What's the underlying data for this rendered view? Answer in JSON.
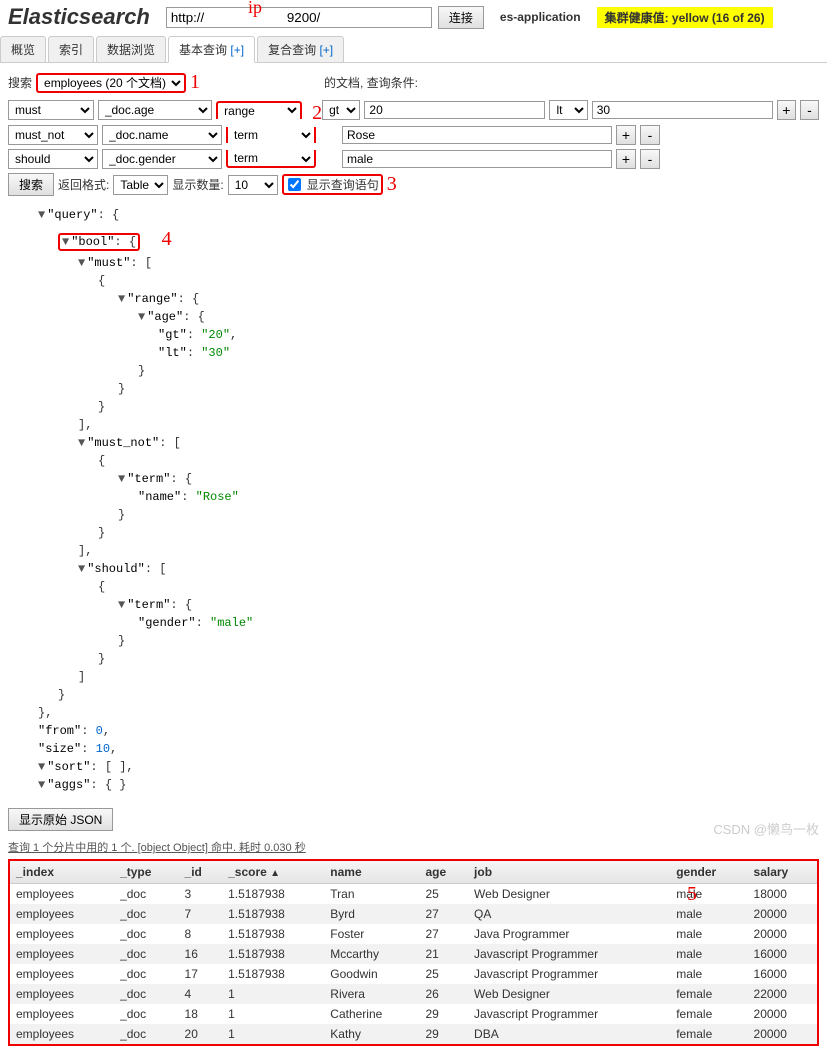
{
  "header": {
    "logo": "Elasticsearch",
    "url_prefix": "http://",
    "url_suffix": "9200/",
    "ip_annotation": "ip",
    "connect": "连接",
    "app_name": "es-application",
    "health": "集群健康值: yellow (16 of 26)"
  },
  "tabs": {
    "overview": "概览",
    "indices": "索引",
    "browse": "数据浏览",
    "basic": "基本查询",
    "compound": "复合查询",
    "plus": "[+]"
  },
  "search": {
    "label": "搜索",
    "index_value": "employees (20 个文档)",
    "docs_label": "的文档, 查询条件:",
    "rows": [
      {
        "bool": "must",
        "field": "_doc.age",
        "op": "range",
        "param": "gt",
        "val1": "20",
        "param2": "lt",
        "val2": "30"
      },
      {
        "bool": "must_not",
        "field": "_doc.name",
        "op": "term",
        "val": "Rose"
      },
      {
        "bool": "should",
        "field": "_doc.gender",
        "op": "term",
        "val": "male"
      }
    ],
    "submit": "搜索",
    "format_label": "返回格式:",
    "format": "Table",
    "count_label": "显示数量:",
    "count": "10",
    "show_query": "显示查询语句"
  },
  "annotations": {
    "a1": "1",
    "a2": "2",
    "a3": "3",
    "a4": "4",
    "a5": "5"
  },
  "json": {
    "query": "\"query\"",
    "bool": "\"bool\"",
    "must": "\"must\"",
    "range": "\"range\"",
    "age": "\"age\"",
    "gt": "\"gt\"",
    "gt_v": "\"20\"",
    "lt": "\"lt\"",
    "lt_v": "\"30\"",
    "must_not": "\"must_not\"",
    "term": "\"term\"",
    "name": "\"name\"",
    "name_v": "\"Rose\"",
    "should": "\"should\"",
    "gender": "\"gender\"",
    "gender_v": "\"male\"",
    "from": "\"from\"",
    "from_v": "0",
    "size": "\"size\"",
    "size_v": "10",
    "sort": "\"sort\"",
    "aggs": "\"aggs\""
  },
  "raw_json_btn": "显示原始 JSON",
  "stats": "查询 1 个分片中用的 1 个. [object Object] 命中. 耗时 0.030 秒",
  "table": {
    "headers": {
      "index": "_index",
      "type": "_type",
      "id": "_id",
      "score": "_score",
      "name": "name",
      "age": "age",
      "job": "job",
      "gender": "gender",
      "salary": "salary"
    },
    "sort_indicator": "▲",
    "rows": [
      {
        "index": "employees",
        "type": "_doc",
        "id": "3",
        "score": "1.5187938",
        "name": "Tran",
        "age": "25",
        "job": "Web Designer",
        "gender": "male",
        "salary": "18000"
      },
      {
        "index": "employees",
        "type": "_doc",
        "id": "7",
        "score": "1.5187938",
        "name": "Byrd",
        "age": "27",
        "job": "QA",
        "gender": "male",
        "salary": "20000"
      },
      {
        "index": "employees",
        "type": "_doc",
        "id": "8",
        "score": "1.5187938",
        "name": "Foster",
        "age": "27",
        "job": "Java Programmer",
        "gender": "male",
        "salary": "20000"
      },
      {
        "index": "employees",
        "type": "_doc",
        "id": "16",
        "score": "1.5187938",
        "name": "Mccarthy",
        "age": "21",
        "job": "Javascript Programmer",
        "gender": "male",
        "salary": "16000"
      },
      {
        "index": "employees",
        "type": "_doc",
        "id": "17",
        "score": "1.5187938",
        "name": "Goodwin",
        "age": "25",
        "job": "Javascript Programmer",
        "gender": "male",
        "salary": "16000"
      },
      {
        "index": "employees",
        "type": "_doc",
        "id": "4",
        "score": "1",
        "name": "Rivera",
        "age": "26",
        "job": "Web Designer",
        "gender": "female",
        "salary": "22000"
      },
      {
        "index": "employees",
        "type": "_doc",
        "id": "18",
        "score": "1",
        "name": "Catherine",
        "age": "29",
        "job": "Javascript Programmer",
        "gender": "female",
        "salary": "20000"
      },
      {
        "index": "employees",
        "type": "_doc",
        "id": "20",
        "score": "1",
        "name": "Kathy",
        "age": "29",
        "job": "DBA",
        "gender": "female",
        "salary": "20000"
      }
    ]
  },
  "watermark": "CSDN @懒鸟一枚"
}
